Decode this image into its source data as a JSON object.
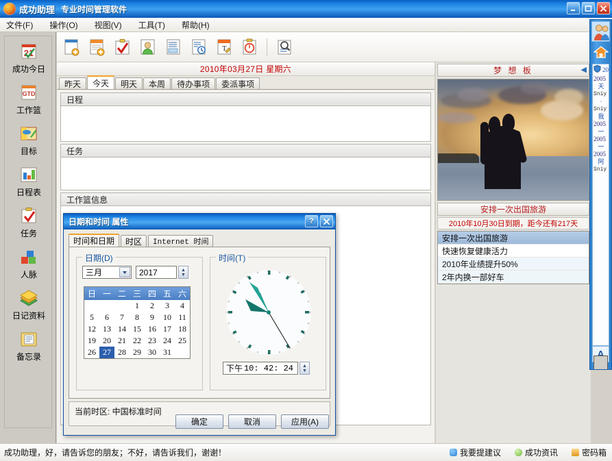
{
  "window": {
    "title": "成功助理",
    "subtitle": "专业时间管理软件",
    "minimize_label": "最小化",
    "maximize_label": "最大化",
    "close_label": "关闭"
  },
  "menubar": {
    "items": [
      {
        "label": "文件(F)"
      },
      {
        "label": "操作(O)"
      },
      {
        "label": "视图(V)"
      },
      {
        "label": "工具(T)"
      },
      {
        "label": "帮助(H)"
      }
    ]
  },
  "sidebar": {
    "items": [
      {
        "label": "成功今日",
        "icon": "calendar-21-icon"
      },
      {
        "label": "工作篮",
        "icon": "gtd-basket-icon"
      },
      {
        "label": "目标",
        "icon": "goal-target-icon"
      },
      {
        "label": "日程表",
        "icon": "bar-chart-icon"
      },
      {
        "label": "任务",
        "icon": "clipboard-check-icon"
      },
      {
        "label": "人脉",
        "icon": "contacts-cubes-icon"
      },
      {
        "label": "日记资料",
        "icon": "books-icon"
      },
      {
        "label": "备忘录",
        "icon": "memo-folder-icon"
      }
    ]
  },
  "toolbar": {
    "buttons": [
      {
        "name": "new-schedule-icon",
        "tooltip": "新建日程"
      },
      {
        "name": "new-task-icon",
        "tooltip": "新建任务"
      },
      {
        "name": "new-todo-icon",
        "tooltip": "新建待办"
      },
      {
        "name": "new-contact-icon",
        "tooltip": "新建人脉"
      },
      {
        "name": "new-note-icon",
        "tooltip": "新建记录"
      },
      {
        "name": "history-icon",
        "tooltip": "历史记录"
      },
      {
        "name": "text-memo-icon",
        "tooltip": "备忘录"
      },
      {
        "name": "timer-icon",
        "tooltip": "计时器"
      },
      {
        "name": "search-icon",
        "tooltip": "查找"
      }
    ]
  },
  "center": {
    "date_header": "2010年03月27日  星期六",
    "tabs": [
      {
        "label": "昨天",
        "active": false
      },
      {
        "label": "今天",
        "active": true
      },
      {
        "label": "明天",
        "active": false
      },
      {
        "label": "本周",
        "active": false
      },
      {
        "label": "待办事项",
        "active": false
      },
      {
        "label": "委派事项",
        "active": false
      }
    ],
    "sections": [
      {
        "title": "日程"
      },
      {
        "title": "任务"
      },
      {
        "title": "工作篮信息"
      }
    ]
  },
  "dream_board": {
    "header": "梦 想 板",
    "collapse_icon": "left-arrow-icon",
    "goal_title": "安排一次出国旅游",
    "goal_due": "2010年10月30日到期，距今还有217天",
    "goals": [
      {
        "label": "安排一次出国旅游",
        "selected": true
      },
      {
        "label": "快速恢复健康活力",
        "selected": false
      },
      {
        "label": "2010年业绩提升50%",
        "selected": false
      },
      {
        "label": "2年内换一部好车",
        "selected": false
      }
    ]
  },
  "side_dock": {
    "avatar_icon": "contacts-avatar-icon",
    "home_icon": "home-icon",
    "shield_icon": "shield-icon",
    "lines": [
      {
        "text": "2005",
        "kind": "year"
      },
      {
        "text": "天",
        "kind": "cn"
      },
      {
        "text": "Sniy",
        "kind": "name"
      },
      {
        "text": "·",
        "kind": "cn"
      },
      {
        "text": "Sniy",
        "kind": "name"
      },
      {
        "text": "我",
        "kind": "cn"
      },
      {
        "text": "2005",
        "kind": "year"
      },
      {
        "text": "一",
        "kind": "cn"
      },
      {
        "text": "2005",
        "kind": "year"
      },
      {
        "text": "一",
        "kind": "cn"
      },
      {
        "text": "2005",
        "kind": "year"
      },
      {
        "text": "阿",
        "kind": "cn"
      },
      {
        "text": "Sniy",
        "kind": "name"
      }
    ],
    "font_label": "A"
  },
  "statusbar": {
    "message": "成功助理，好，请告诉您的朋友；不好，请告诉我们，谢谢！",
    "items": [
      {
        "label": "我要提建议",
        "icon": "suggestion-icon",
        "color": "#2f7fd4"
      },
      {
        "label": "成功资讯",
        "icon": "news-icon",
        "color": "#7ec142"
      },
      {
        "label": "密码箱",
        "icon": "lock-icon",
        "color": "#f0a828"
      }
    ]
  },
  "dialog": {
    "title": "日期和时间 属性",
    "help_label": "?",
    "close_label": "✕",
    "tabs": [
      {
        "label": "时间和日期",
        "active": true,
        "mono": false
      },
      {
        "label": "时区",
        "active": false,
        "mono": false
      },
      {
        "label": "Internet 时间",
        "active": false,
        "mono": true
      }
    ],
    "date_group": {
      "legend": "日期(D)",
      "month": "三月",
      "year": "2017",
      "weekday_headers": [
        "日",
        "一",
        "二",
        "三",
        "四",
        "五",
        "六"
      ],
      "weeks": [
        [
          "",
          "",
          "",
          "1",
          "2",
          "3",
          "4"
        ],
        [
          "5",
          "6",
          "7",
          "8",
          "9",
          "10",
          "11"
        ],
        [
          "12",
          "13",
          "14",
          "15",
          "16",
          "17",
          "18"
        ],
        [
          "19",
          "20",
          "21",
          "22",
          "23",
          "24",
          "25"
        ],
        [
          "26",
          "27",
          "28",
          "29",
          "30",
          "31",
          ""
        ]
      ],
      "selected_day": "27"
    },
    "time_group": {
      "legend": "时间(T)",
      "meridiem": "下午",
      "time": "10: 42: 24",
      "clock": {
        "hour": 22,
        "minute": 42,
        "second": 24
      }
    },
    "timezone_text": "当前时区: 中国标准时间",
    "buttons": [
      {
        "label": "确定"
      },
      {
        "label": "取消"
      },
      {
        "label": "应用(A)"
      }
    ]
  }
}
